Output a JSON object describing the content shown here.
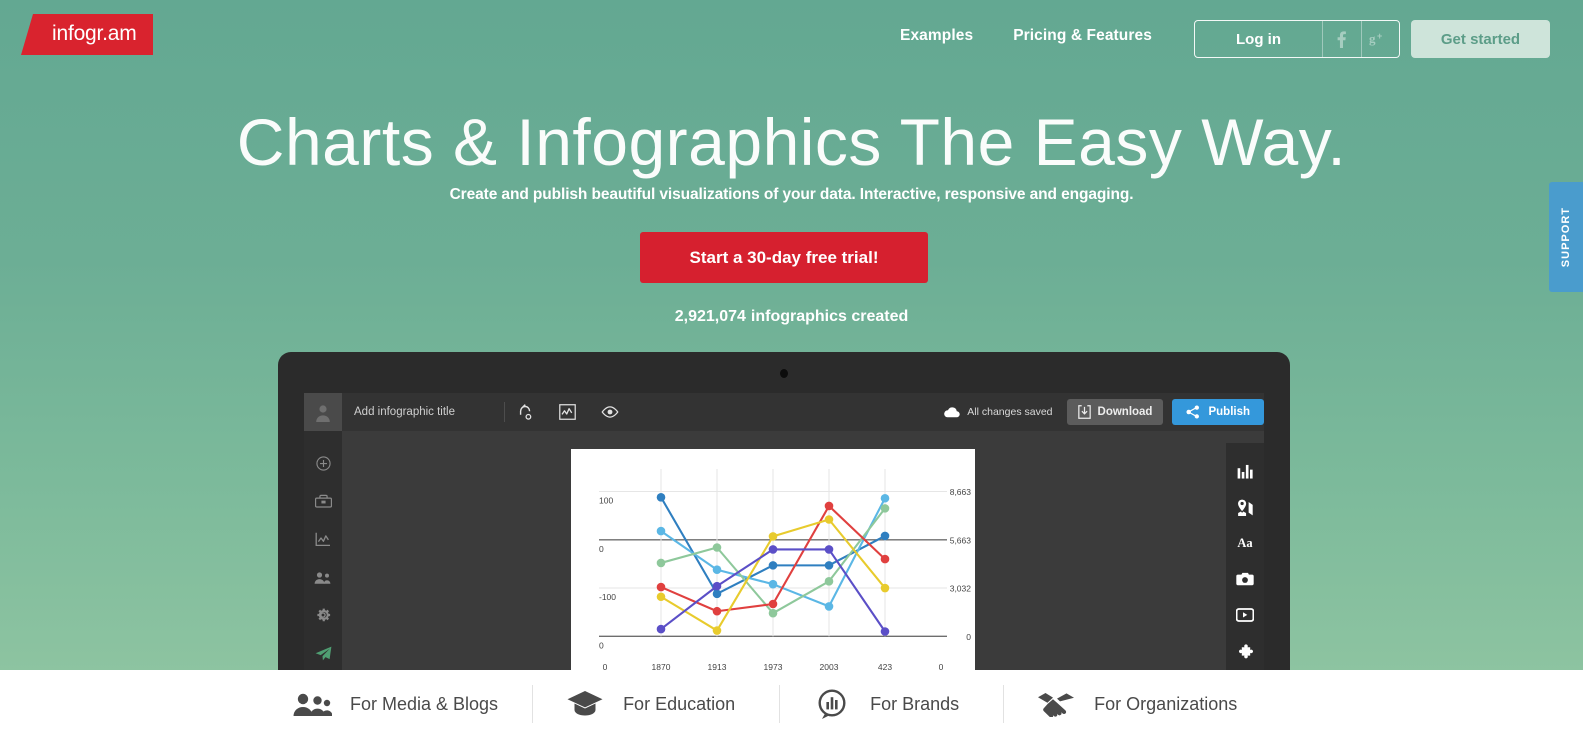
{
  "header": {
    "logo_text": "infogr.am",
    "nav": [
      {
        "label": "Examples",
        "name": "nav-examples"
      },
      {
        "label": "Pricing & Features",
        "name": "nav-pricing-features"
      }
    ],
    "login_label": "Log in",
    "facebook_icon": "facebook-icon",
    "google_plus_icon": "google-plus-icon",
    "get_started_label": "Get started"
  },
  "hero": {
    "title": "Charts & Infographics The Easy Way.",
    "subtitle": "Create and publish beautiful visualizations of your data. Interactive, responsive and engaging.",
    "cta_label": "Start a 30-day free trial!",
    "counter_number": "2,921,074",
    "counter_text": "infographics created"
  },
  "support_tab": {
    "label": "SUPPORT"
  },
  "editor": {
    "title_placeholder": "Add infographic title",
    "toolbar_icons": [
      {
        "name": "undo-icon"
      },
      {
        "name": "chart-icon"
      },
      {
        "name": "preview-eye-icon"
      }
    ],
    "saved_status": "All changes saved",
    "download_label": "Download",
    "publish_label": "Publish",
    "left_rail_icons": [
      {
        "name": "add-circle-icon"
      },
      {
        "name": "library-icon"
      },
      {
        "name": "chart-icon"
      },
      {
        "name": "team-icon"
      },
      {
        "name": "settings-gear-icon"
      },
      {
        "name": "send-plane-icon"
      }
    ],
    "right_rail_icons": [
      {
        "name": "bar-chart-icon"
      },
      {
        "name": "map-pin-icon"
      },
      {
        "name": "text-aa-icon"
      },
      {
        "name": "photo-camera-icon"
      },
      {
        "name": "video-play-icon"
      },
      {
        "name": "puzzle-piece-icon"
      }
    ]
  },
  "chart_data": {
    "type": "line",
    "title": "",
    "xlabel": "",
    "ylabel": "",
    "grid": true,
    "legend": "none",
    "x": [
      "0",
      "1870",
      "1913",
      "1973",
      "2003",
      "423",
      "0"
    ],
    "categories": [
      "1870",
      "1913",
      "1973",
      "2003",
      "423"
    ],
    "y_axis_left_ticks": [
      "100",
      "0",
      "-100",
      "0"
    ],
    "y_axis_right_ticks": [
      "8,663",
      "5,663",
      "3,032",
      "0"
    ],
    "ylim": [
      -220,
      130
    ],
    "colors": {
      "blue": "#2f7fc0",
      "lightblue": "#5bb7e5",
      "green": "#8ec89b",
      "red": "#e0403f",
      "yellow": "#e8cb2d",
      "purple": "#5b4fc7"
    },
    "series": [
      {
        "name": "blue",
        "color": "#2f7fc0",
        "values": [
          88,
          -112,
          -53,
          -53,
          8
        ]
      },
      {
        "name": "lightblue",
        "color": "#5bb7e5",
        "values": [
          18,
          -62,
          -92,
          -138,
          86
        ]
      },
      {
        "name": "green",
        "color": "#8ec89b",
        "values": [
          -48,
          -16,
          -152,
          -86,
          65
        ]
      },
      {
        "name": "red",
        "color": "#e0403f",
        "values": [
          -98,
          -148,
          -133,
          70,
          -40
        ]
      },
      {
        "name": "yellow",
        "color": "#e8cb2d",
        "values": [
          -118,
          -188,
          7,
          42,
          -100
        ]
      },
      {
        "name": "purple",
        "color": "#5b4fc7",
        "values": [
          -185,
          -96,
          -20,
          -20,
          -190
        ]
      }
    ]
  },
  "bottom_bar": {
    "items": [
      {
        "label": "For Media & Blogs",
        "icon": "people-icon",
        "name": "bottom-item-media-blogs"
      },
      {
        "label": "For Education",
        "icon": "graduation-cap-icon",
        "name": "bottom-item-education"
      },
      {
        "label": "For Brands",
        "icon": "chart-bubble-icon",
        "name": "bottom-item-brands"
      },
      {
        "label": "For Organizations",
        "icon": "handshake-icon",
        "name": "bottom-item-organizations"
      }
    ]
  },
  "colors": {
    "brand_red": "#d6202f",
    "bg_green_top": "#63a892",
    "bg_green_bottom": "#93c7a3",
    "accent_blue": "#3498db",
    "support_blue": "#4a9ccd"
  }
}
